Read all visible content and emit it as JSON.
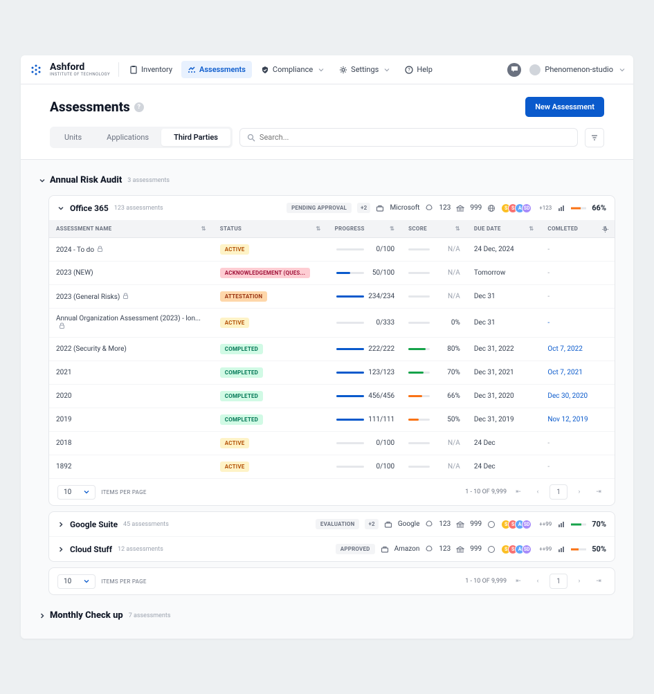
{
  "brand": {
    "name": "Ashford",
    "sub": "INSTITUTE OF TECHNOLOGY"
  },
  "nav": {
    "inventory": "Inventory",
    "assessments": "Assessments",
    "compliance": "Compliance",
    "settings": "Settings",
    "help": "Help"
  },
  "user": {
    "name": "Phenomenon-studio"
  },
  "page": {
    "title": "Assessments",
    "newBtn": "New Assessment"
  },
  "tabs": {
    "units": "Units",
    "applications": "Applications",
    "thirdParties": "Third Parties"
  },
  "search": {
    "placeholder": "Search..."
  },
  "section1": {
    "title": "Annual Risk Audit",
    "sub": "3 assessments"
  },
  "grp1": {
    "title": "Office 365",
    "sub": "123 assessments",
    "badge": "PENDING APPROVAL",
    "plus": "+2",
    "vendor": "Microsoft",
    "rocket": "123",
    "bank": "999",
    "avplus": "+123",
    "pct": "66%"
  },
  "th": {
    "name": "ASSESSMENT NAME",
    "status": "STATUS",
    "progress": "PROGRESS",
    "score": "SCORE",
    "due": "DUE DATE",
    "comp": "COMLETED"
  },
  "rows": [
    {
      "name": "2024 - To do",
      "lock": true,
      "status": "ACTIVE",
      "stClass": "st-active",
      "prog": "0/100",
      "progPct": 0,
      "score": "N/A",
      "scorePct": 0,
      "due": "24 Dec, 2024",
      "comp": "-"
    },
    {
      "name": "2023 (NEW)",
      "lock": false,
      "status": "ACKNOWLEDGEMENT (QUES...",
      "stClass": "st-ack",
      "prog": "50/100",
      "progPct": 50,
      "score": "N/A",
      "scorePct": 0,
      "due": "Tomorrow",
      "dueWarn": true,
      "comp": "-"
    },
    {
      "name": "2023 (General Risks)",
      "lock": true,
      "status": "ATTESTATION",
      "stClass": "st-att",
      "prog": "234/234",
      "progPct": 100,
      "score": "N/A",
      "scorePct": 0,
      "due": "Dec 31",
      "comp": "-"
    },
    {
      "name": "Annual Organization Assessment (2023) - lon...",
      "lock": true,
      "status": "ACTIVE",
      "stClass": "st-active",
      "prog": "0/333",
      "progPct": 0,
      "score": "0%",
      "scorePct": 0,
      "due": "Dec 31",
      "comp": "-",
      "compLink": true
    },
    {
      "name": "2022 (Security & More)",
      "lock": false,
      "status": "COMPLETED",
      "stClass": "st-comp",
      "prog": "222/222",
      "progPct": 100,
      "score": "80%",
      "scorePct": 80,
      "scoreColor": "green",
      "due": "Dec 31, 2022",
      "comp": "Oct 7, 2022",
      "compLink": true
    },
    {
      "name": "2021",
      "lock": false,
      "status": "COMPLETED",
      "stClass": "st-comp",
      "prog": "123/123",
      "progPct": 100,
      "score": "70%",
      "scorePct": 70,
      "scoreColor": "green",
      "due": "Dec 31, 2021",
      "comp": "Oct 7, 2021",
      "compLink": true
    },
    {
      "name": "2020",
      "lock": false,
      "status": "COMPLETED",
      "stClass": "st-comp",
      "prog": "456/456",
      "progPct": 100,
      "score": "66%",
      "scorePct": 66,
      "scoreColor": "orange",
      "due": "Dec 31, 2020",
      "comp": "Dec 30, 2020",
      "compLink": true
    },
    {
      "name": "2019",
      "lock": false,
      "status": "COMPLETED",
      "stClass": "st-comp",
      "prog": "111/111",
      "progPct": 100,
      "score": "50%",
      "scorePct": 50,
      "scoreColor": "orange",
      "due": "Dec 31, 2019",
      "comp": "Nov 12, 2019",
      "compLink": true
    },
    {
      "name": "2018",
      "lock": false,
      "status": "ACTIVE",
      "stClass": "st-active",
      "prog": "0/100",
      "progPct": 0,
      "score": "N/A",
      "scorePct": 0,
      "due": "24 Dec",
      "comp": "-"
    },
    {
      "name": "1892",
      "lock": false,
      "status": "ACTIVE",
      "stClass": "st-active",
      "prog": "0/100",
      "progPct": 0,
      "score": "N/A",
      "scorePct": 0,
      "due": "24 Dec",
      "comp": "-"
    }
  ],
  "pager": {
    "pp": "10",
    "ppLabel": "ITEMS PER PAGE",
    "range": "1 - 10 OF 9,999",
    "page": "1"
  },
  "grp2": {
    "title": "Google Suite",
    "sub": "45 assessments",
    "badge": "EVALUATION",
    "plus": "+2",
    "vendor": "Google",
    "rocket": "123",
    "bank": "999",
    "avplus": "++99",
    "pct": "70%",
    "pctColor": "green"
  },
  "grp3": {
    "title": "Cloud Stuff",
    "sub": "12 assessments",
    "badge": "APPROVED",
    "vendor": "Amazon",
    "rocket": "123",
    "bank": "999",
    "avplus": "++99",
    "pct": "50%",
    "pctColor": "orange"
  },
  "pager2": {
    "pp": "10",
    "ppLabel": "ITEMS PER PAGE",
    "range": "1 - 10 OF 9,999",
    "page": "1"
  },
  "section2": {
    "title": "Monthly Check up",
    "sub": "7 assessments"
  }
}
